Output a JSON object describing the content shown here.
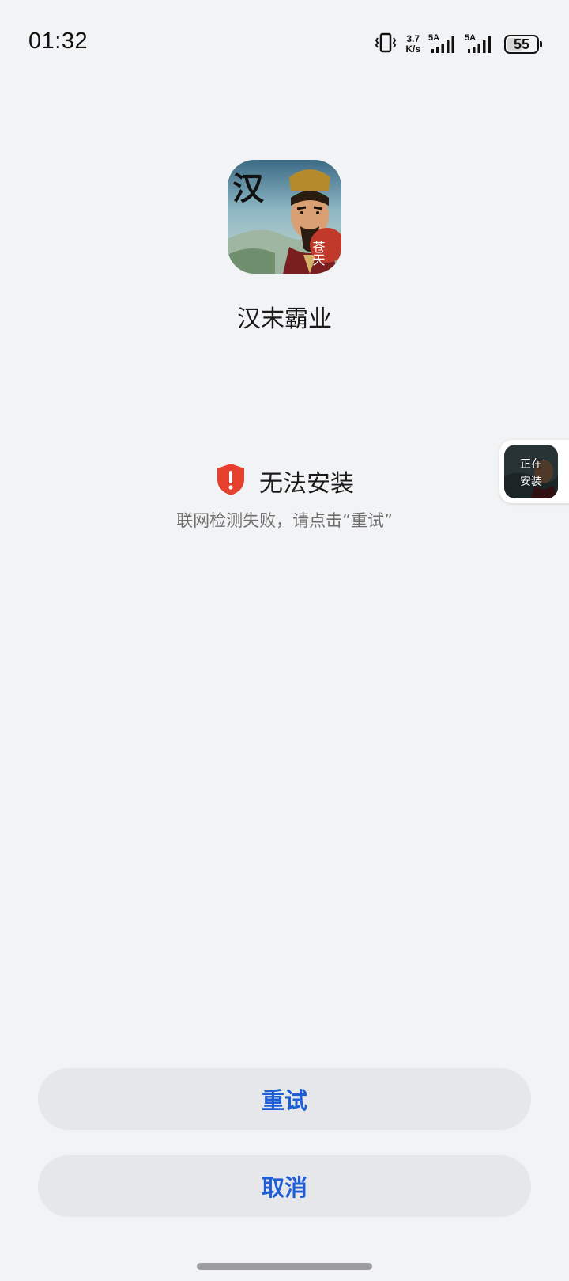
{
  "status_bar": {
    "time": "01:32",
    "net_speed_value": "3.7",
    "net_speed_unit": "K/s",
    "sim1_label": "5A",
    "sim2_label": "5A",
    "battery_level": "55",
    "battery_fraction": 0.55,
    "icons": [
      "vibrate-icon",
      "signal-icon",
      "signal-icon",
      "battery-icon"
    ]
  },
  "app": {
    "name": "汉末霸业",
    "icon_text_top": "汉",
    "icon_text_badge": "苍天"
  },
  "install_status": {
    "title": "无法安装",
    "description": "联网检测失败，请点击“重试”",
    "icon": "shield-alert-icon",
    "icon_color": "#e8402f"
  },
  "floating_bubble": {
    "label_line1": "正在",
    "label_line2": "安装"
  },
  "buttons": {
    "retry_label": "重试",
    "cancel_label": "取消",
    "accent_color": "#1f5fd6"
  }
}
